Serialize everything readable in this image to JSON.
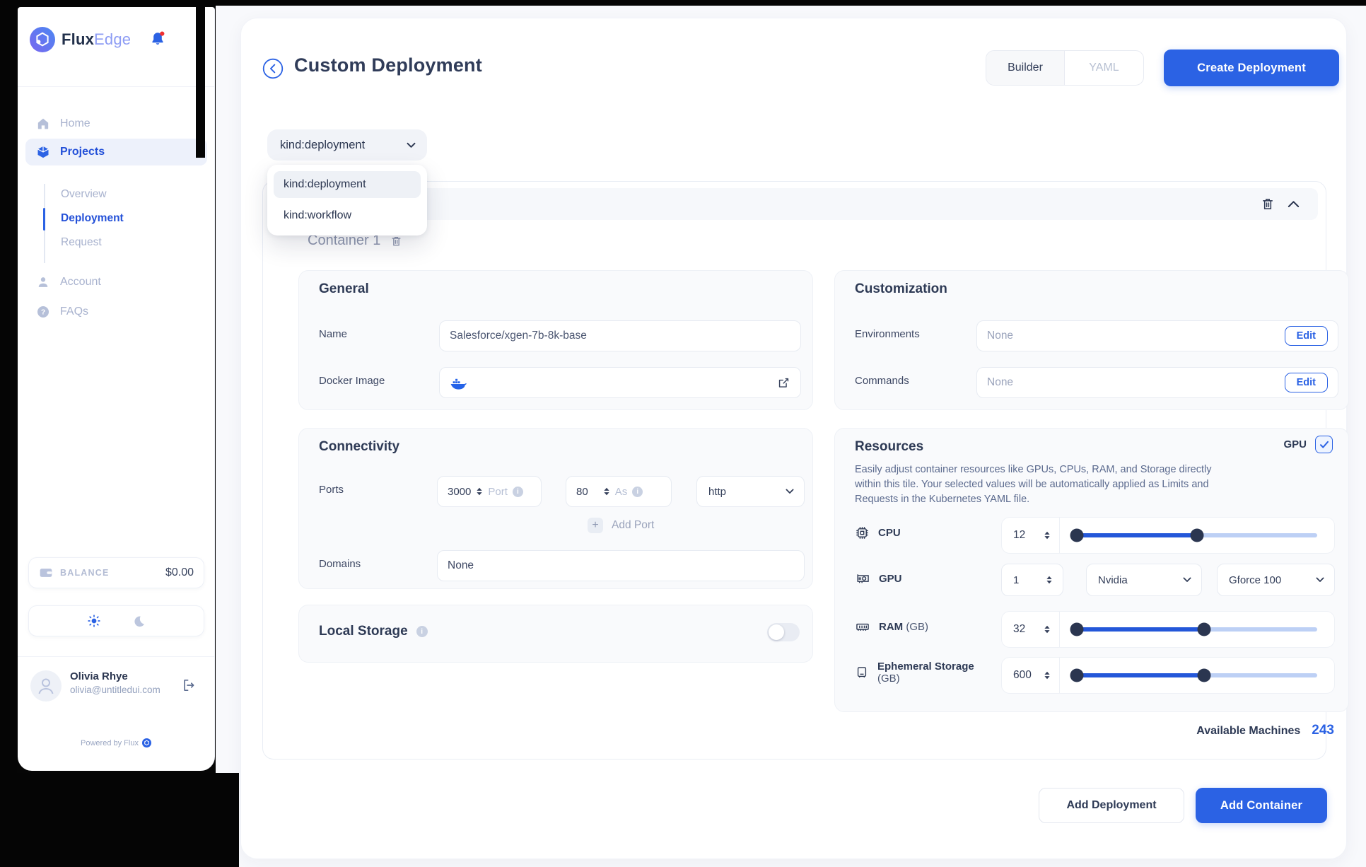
{
  "icons": {
    "plus": "+",
    "question": "?",
    "info": "i"
  },
  "sidebar": {
    "brand_primary": "Flux",
    "brand_secondary": "Edge",
    "nav_home": "Home",
    "nav_projects": "Projects",
    "nav_account": "Account",
    "nav_faqs": "FAQs",
    "subnav": [
      {
        "label": "Overview"
      },
      {
        "label": "Deployment"
      },
      {
        "label": "Request"
      }
    ],
    "balance_label": "BALANCE",
    "balance_value": "$0.00",
    "user_name": "Olivia Rhye",
    "user_email": "olivia@untitledui.com",
    "powered_by": "Powered by Flux"
  },
  "header": {
    "title": "Custom Deployment",
    "builder_tab": "Builder",
    "yaml_tab": "YAML",
    "create_button": "Create Deployment"
  },
  "kind_select": {
    "value": "kind:deployment",
    "options": [
      {
        "label": "kind:deployment"
      },
      {
        "label": "kind:workflow"
      }
    ]
  },
  "container_section": {
    "title": "Container 1"
  },
  "general": {
    "heading": "General",
    "name_label": "Name",
    "name_value": "Salesforce/xgen-7b-8k-base",
    "docker_label": "Docker Image"
  },
  "customization": {
    "heading": "Customization",
    "environments_label": "Environments",
    "environments_value": "None",
    "commands_label": "Commands",
    "commands_value": "None",
    "edit_label": "Edit"
  },
  "connectivity": {
    "heading": "Connectivity",
    "ports_label": "Ports",
    "port_value": "3000",
    "port_suffix": "Port",
    "as_value": "80",
    "as_suffix": "As",
    "protocol": "http",
    "add_port_label": "Add Port",
    "domains_label": "Domains",
    "domains_value": "None"
  },
  "local_storage": {
    "heading": "Local Storage",
    "enabled": false
  },
  "resources": {
    "heading": "Resources",
    "gpu_toggle_label": "GPU",
    "description": "Easily adjust container resources like GPUs, CPUs, RAM, and Storage directly within this tile. Your selected values will be automatically applied as Limits and Requests in the Kubernetes YAML file.",
    "cpu": {
      "label": "CPU",
      "value": "12",
      "slider_percent": 50
    },
    "gpu": {
      "label": "GPU",
      "value": "1",
      "vendor": "Nvidia",
      "model": "Gforce 100"
    },
    "ram": {
      "label": "RAM",
      "unit": "(GB)",
      "value": "32",
      "slider_percent": 53
    },
    "ephemeral": {
      "label": "Ephemeral Storage",
      "unit": "(GB)",
      "value": "600",
      "slider_percent": 53
    },
    "available_machines_label": "Available Machines",
    "available_machines_value": "243"
  },
  "footer": {
    "add_deployment": "Add Deployment",
    "add_container": "Add Container"
  },
  "colors": {
    "primary": "#2b62e4",
    "slider_rest": "#bdd0f5",
    "handle": "#2b3650",
    "danger_dot": "#f03030"
  }
}
